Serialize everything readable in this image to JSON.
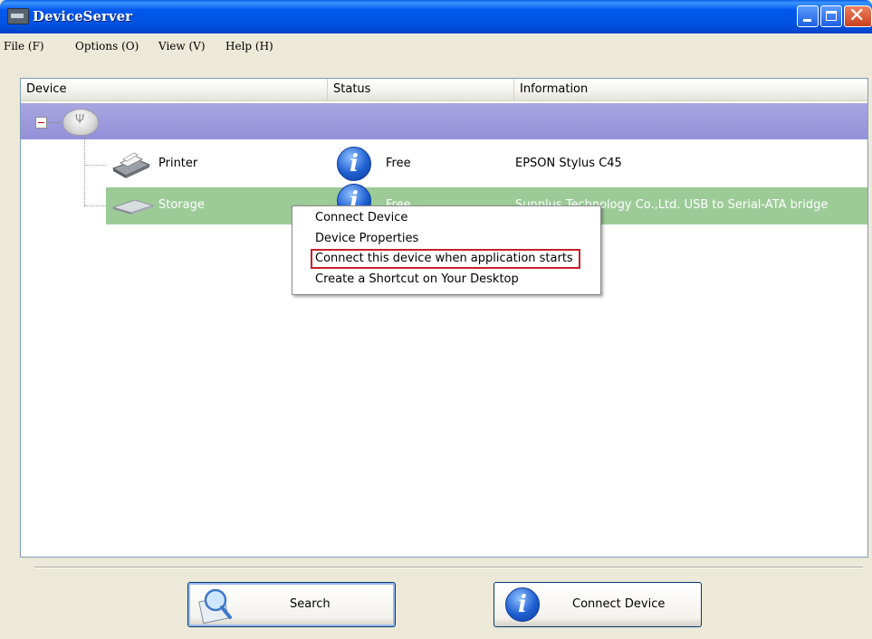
{
  "window": {
    "title": "DeviceServer"
  },
  "menubar": {
    "items": [
      "File (F)",
      "Options (O)",
      "View (V)",
      "Help (H)"
    ]
  },
  "list": {
    "columns": [
      "Device",
      "Status",
      "Information"
    ],
    "rows": [
      {
        "device": "Printer",
        "status": "Free",
        "information": "EPSON Stylus C45"
      },
      {
        "device": "Storage",
        "status": "Free",
        "information": "Sunplus Technology Co.,Ltd. USB to Serial-ATA bridge"
      }
    ]
  },
  "context_menu": {
    "items": [
      "Connect Device",
      "Device Properties",
      "Connect this device when application starts",
      "Create a Shortcut on Your Desktop"
    ],
    "highlighted_item": "Connect this device when application starts"
  },
  "buttons": {
    "search_label": "Search",
    "connect_label": "Connect Device"
  },
  "colors": {
    "title_bar": "#0053E1",
    "selected_root_row": "#9A97DC",
    "selected_storage_row": "#9CCB98",
    "highlight_border": "#C8202A"
  },
  "icons": [
    "app-icon",
    "minimize-icon",
    "maximize-icon",
    "close-icon",
    "tree-collapse-icon",
    "usb-hub-icon",
    "printer-icon",
    "info-icon",
    "storage-icon",
    "search-magnifier-icon"
  ]
}
